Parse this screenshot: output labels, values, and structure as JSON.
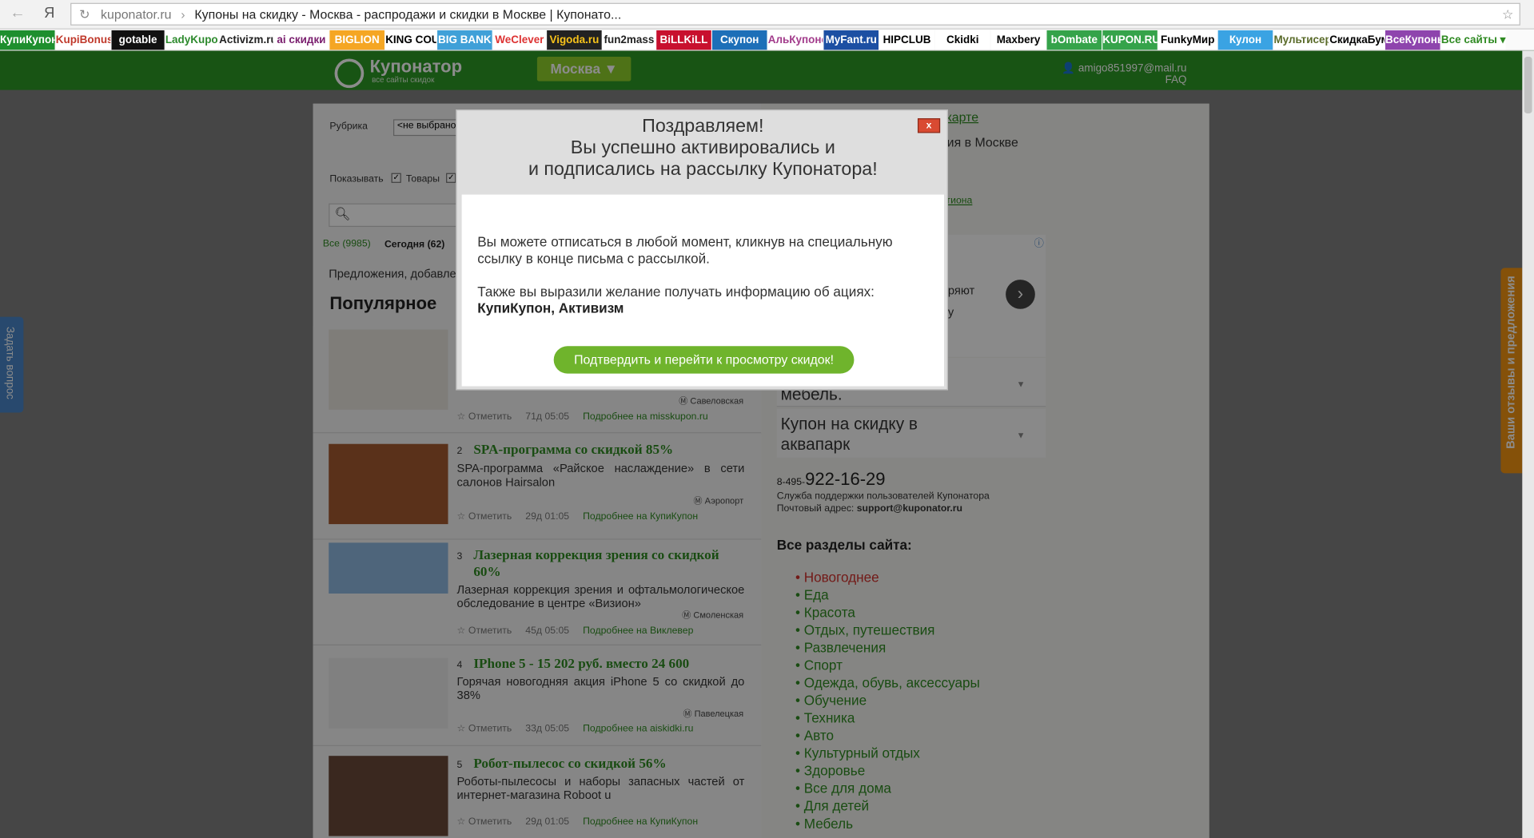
{
  "browser": {
    "url_domain": "kuponator.ru",
    "url_sep": "›",
    "page_title": "Купоны на скидку - Москва - распродажи и скидки в Москве | Купонато...",
    "bookmarks": [
      "КупиКупон",
      "KupiBonus",
      "gotable",
      "LadyKupon",
      "Activizm.ru",
      "ai скидки",
      "BIGLION",
      "KING COUPON",
      "BIG BANK",
      "WeClever",
      "Vigoda.ru",
      "fun2mass",
      "BiLLKiLL",
      "Скупон",
      "АльКупоне",
      "MyFant.ru",
      "HIPCLUB",
      "Ckidki",
      "Maxbery",
      "bOmbate",
      "KUPON.RU",
      "FunkyМир",
      "Кулон",
      "Мультисервис",
      "СкидкаБум",
      "ВсеКупоны",
      "Все сайты ▾"
    ]
  },
  "header": {
    "logo_title": "Купонатор",
    "logo_subtitle": "все сайты скидок",
    "city": "Москва ▼",
    "user_email": "amigo851997@mail.ru",
    "faq": "FAQ"
  },
  "filters": {
    "rubric_label": "Рубрика",
    "rubric_value": "<не выбрано",
    "show_label": "Показывать",
    "goods_label": "Товары",
    "all_tab": "Все (9985)",
    "today_tab": "Сегодня (62)",
    "offers_text": "Предложения, добавлен"
  },
  "popular_heading": "Популярное",
  "deals": [
    {
      "num": "",
      "title": "",
      "desc": "",
      "metro": "Савеловская",
      "mark": "Отметить",
      "age": "71д 05:05",
      "more": "Подробнее на",
      "source": "misskupon.ru"
    },
    {
      "num": "2",
      "title": "SPA-программа со скидкой 85%",
      "desc": "SPA-программа «Райское наслаждение» в сети салонов Hairsalon",
      "metro": "Аэропорт",
      "mark": "Отметить",
      "age": "29д 01:05",
      "more": "Подробнее на",
      "source": "КупиКупон"
    },
    {
      "num": "3",
      "title": "Лазерная коррекция зрения со скидкой 60%",
      "desc": "Лазерная коррекция зрения и офтальмологическое обследование в центре «Визион»",
      "metro": "Смоленская",
      "mark": "Отметить",
      "age": "45д 05:05",
      "more": "Подробнее на",
      "source": "Виклевер"
    },
    {
      "num": "4",
      "title": "IPhone 5 - 15 202 руб. вместо 24 600",
      "desc": "Горячая новогодняя акция iPhone 5 со скидкой до 38%",
      "metro": "Павелецкая",
      "mark": "Отметить",
      "age": "33д 05:05",
      "more": "Подробнее на",
      "source": "aiskidki.ru"
    },
    {
      "num": "5",
      "title": "Робот-пылесос со скидкой 56%",
      "desc": "Роботы-пылесосы и наборы запасных частей от интернет-магазина Roboot u",
      "metro": "",
      "mark": "Отметить",
      "age": "29д 01:05",
      "more": "Подробнее на",
      "source": "КупиКупон"
    }
  ],
  "right": {
    "map_link": "карте",
    "city_line": "ия в Москве",
    "region_link": "гиона",
    "ad_text1": "ряют",
    "ad_text2": "у",
    "dropdown1": "мебель.",
    "dropdown2": "Купон на скидку в аквапарк",
    "phone_prefix": "8-495-",
    "phone": "922-16-29",
    "support_text": "Служба поддержки пользователей Купонатора",
    "mail_label": "Почтовый адрес:",
    "mail": "support@kuponator.ru",
    "sections_heading": "Все разделы сайта:",
    "sections": [
      "Новогоднее",
      "Еда",
      "Красота",
      "Отдых, путешествия",
      "Развлечения",
      "Спорт",
      "Одежда, обувь, аксессуары",
      "Обучение",
      "Техника",
      "Авто",
      "Культурный отдых",
      "Здоровье",
      "Все для дома",
      "Для детей",
      "Мебель"
    ]
  },
  "modal": {
    "title_line1": "Поздравляем!",
    "title_line2": "Вы успешно активировались и",
    "title_line3": "и подписались на рассылку Купонатора!",
    "close": "x",
    "p1": "Вы можете отписаться в любой момент, кликнув на специальную ссылку в конце письма с рассылкой.",
    "p2": "Также вы выразили желание получать информацию об ациях:",
    "sites": "КупиКупон, Активизм",
    "button": "Подтвердить и перейти к просмотру скидок!"
  },
  "side": {
    "ask": "Задать вопрос",
    "reviews": "Ваши отзывы и предложения"
  },
  "colors": {
    "header_green": "#2c9a26",
    "accent_green": "#8ecf2a",
    "link_green": "#2f8a22",
    "orange_tab": "#f39412"
  }
}
